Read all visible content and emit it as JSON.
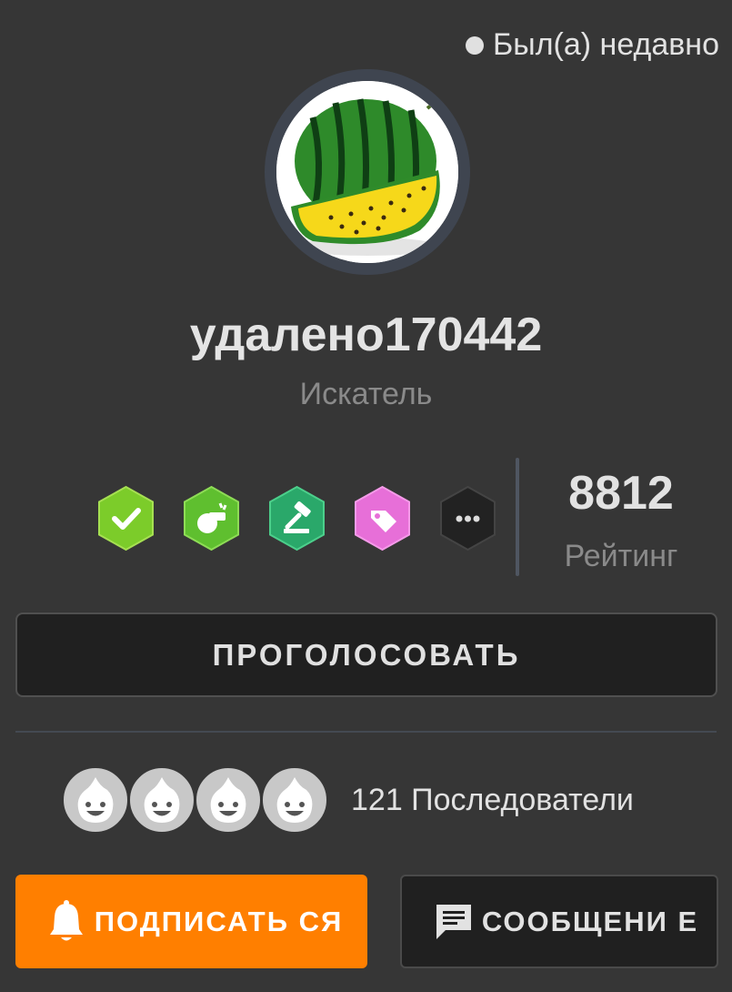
{
  "status": {
    "text": "Был(а) недавно"
  },
  "profile": {
    "username": "удалено170442",
    "rank": "Искатель"
  },
  "badges": [
    {
      "icon": "checkmark-badge-icon",
      "color": "#7ccc2a"
    },
    {
      "icon": "whistle-badge-icon",
      "color": "#5fbf2f"
    },
    {
      "icon": "gavel-badge-icon",
      "color": "#2aa86a"
    },
    {
      "icon": "tag-badge-icon",
      "color": "#e76fd8"
    },
    {
      "icon": "more-badges-icon",
      "color": "#222222"
    }
  ],
  "rating": {
    "value": "8812",
    "label": "Рейтинг"
  },
  "vote_button": {
    "label": "ПРОГОЛОСОВАТЬ"
  },
  "followers": {
    "text": "121 Последователи"
  },
  "subscribe_button": {
    "label": "ПОДПИСАТЬ СЯ",
    "color": "#ff7f00"
  },
  "message_button": {
    "label": "СООБЩЕНИ Е"
  }
}
